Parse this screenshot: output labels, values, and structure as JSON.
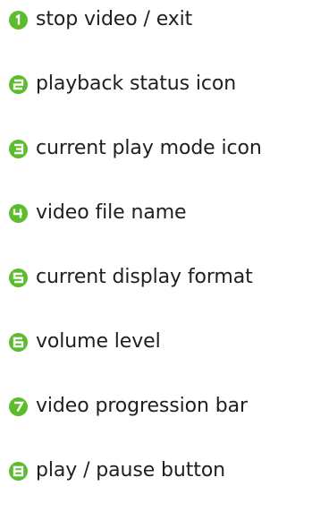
{
  "legend": {
    "badge_color": "#5bbd2c",
    "items": [
      {
        "number": "1",
        "label": "stop video / exit"
      },
      {
        "number": "2",
        "label": "playback status icon"
      },
      {
        "number": "3",
        "label": "current play mode icon"
      },
      {
        "number": "4",
        "label": "video file name"
      },
      {
        "number": "5",
        "label": "current display format"
      },
      {
        "number": "6",
        "label": "volume level"
      },
      {
        "number": "7",
        "label": "video progression bar"
      },
      {
        "number": "8",
        "label": "play / pause button"
      }
    ]
  }
}
